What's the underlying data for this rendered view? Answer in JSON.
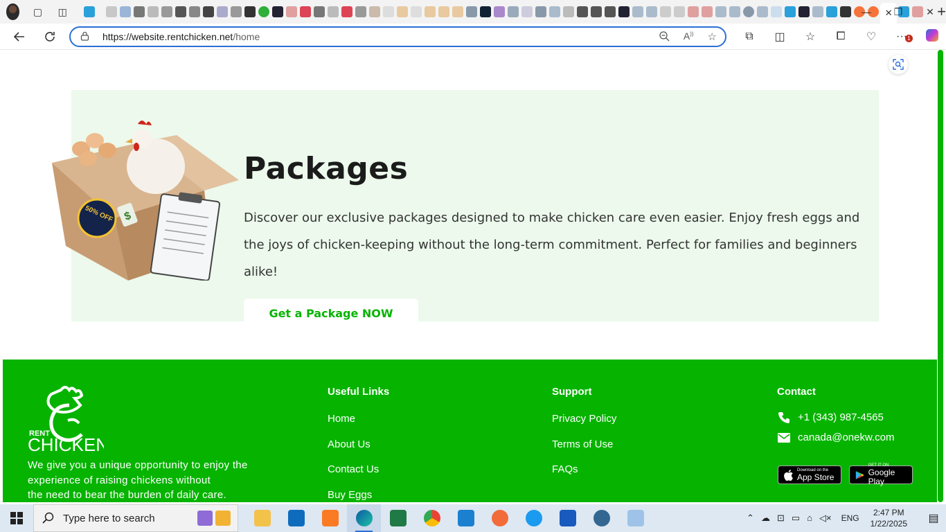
{
  "browser": {
    "url_host": "https://website.rentchicken.net",
    "url_path": "/home",
    "active_tab_close": "✕",
    "new_tab": "+",
    "window_controls": [
      "—",
      "❐",
      "✕"
    ],
    "extension_badge": "1"
  },
  "packages": {
    "title": "Packages",
    "description": "Discover our exclusive packages designed to make chicken care even easier. Enjoy fresh eggs and the joys of chicken-keeping without the long-term commitment. Perfect for families and beginners alike!",
    "cta": "Get a Package NOW",
    "image_badge": "50% OFF"
  },
  "footer": {
    "logo_top": "RENT",
    "logo_bottom": "CHICKEN",
    "tagline_1": "We give you a unique opportunity to enjoy the",
    "tagline_2": "experience of raising chickens without",
    "tagline_3": "the need to bear the burden of daily care.",
    "useful_links": {
      "heading": "Useful Links",
      "items": [
        "Home",
        "About Us",
        "Contact Us",
        "Buy Eggs"
      ]
    },
    "support": {
      "heading": "Support",
      "items": [
        "Privacy Policy",
        "Terms of Use",
        "FAQs"
      ]
    },
    "contact": {
      "heading": "Contact",
      "phone": "+1 (343) 987-4565",
      "email": "canada@onekw.com",
      "app_store_small": "Download on the",
      "app_store_big": "App Store",
      "google_play_small": "GET IT ON",
      "google_play_big": "Google Play"
    }
  },
  "taskbar": {
    "search_placeholder": "Type here to search",
    "language": "ENG",
    "time": "2:47 PM",
    "date": "1/22/2025"
  },
  "colors": {
    "brand_green": "#06b400",
    "packages_bg": "#ecf9ec",
    "url_border": "#2a6fd6"
  }
}
